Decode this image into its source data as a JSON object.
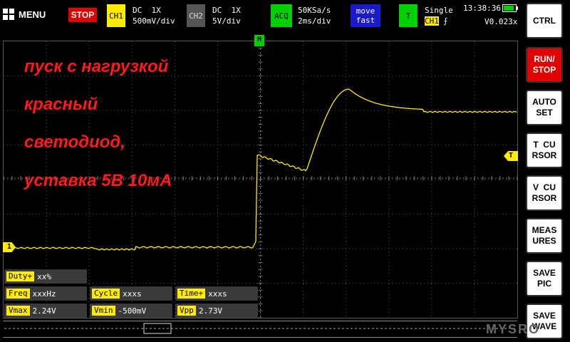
{
  "topbar": {
    "menu_label": "MENU",
    "stop_label": "STOP",
    "ch1": {
      "badge": "CH1",
      "coupling": "DC  1X",
      "scale": "500mV/div",
      "color": "#ffeb00"
    },
    "ch2": {
      "badge": "CH2",
      "coupling": "DC  1X",
      "scale": "5V/div",
      "color": "#555555"
    },
    "acq": {
      "badge": "ACQ",
      "rate": "50KSa/s",
      "timebase": "2ms/div",
      "color": "#00d000"
    },
    "mode": {
      "line1": "move",
      "line2": "fast",
      "color": "#1a1acc"
    },
    "trigger": {
      "badge": "T",
      "mode": "Single",
      "source": "CH1",
      "edge": "⨍",
      "color": "#00d000"
    },
    "clock": "13:38:36",
    "battery_level": 0.85,
    "offset": "V0.023x"
  },
  "side_buttons": [
    {
      "label": "CTRL",
      "active": false
    },
    {
      "label": "RUN/\nSTOP",
      "active": true
    },
    {
      "label": "AUTO\nSET",
      "active": false
    },
    {
      "label": "T  CU\nRSOR",
      "active": false
    },
    {
      "label": "V  CU\nRSOR",
      "active": false
    },
    {
      "label": "MEAS\nURES",
      "active": false
    },
    {
      "label": "SAVE\nPIC",
      "active": false
    },
    {
      "label": "SAVE\nWAVE",
      "active": false
    }
  ],
  "overlay_lines": [
    "пуск с нагрузкой",
    "красный",
    "светодиод,",
    "уставка 5В 10мА"
  ],
  "markers": {
    "trigger_top": "H",
    "trigger_level": "T",
    "ch1_ground": "1"
  },
  "measurements": [
    {
      "label": "Duty+",
      "value": "xx%"
    },
    {
      "label": "Freq",
      "value": "xxxHz"
    },
    {
      "label": "Cycle",
      "value": "xxxs"
    },
    {
      "label": "Time+",
      "value": "xxxs"
    },
    {
      "label": "Vmax",
      "value": "2.24V"
    },
    {
      "label": "Vmin",
      "value": "-500mV"
    },
    {
      "label": "Vpp",
      "value": "2.73V"
    }
  ],
  "watermark": "MYSRO",
  "colors": {
    "trace": "#ffeb00",
    "grid": "#5a5a5a",
    "overlay_text": "#ff1a1a",
    "stop": "#e00000",
    "trigger_marker": "#00d000"
  }
}
